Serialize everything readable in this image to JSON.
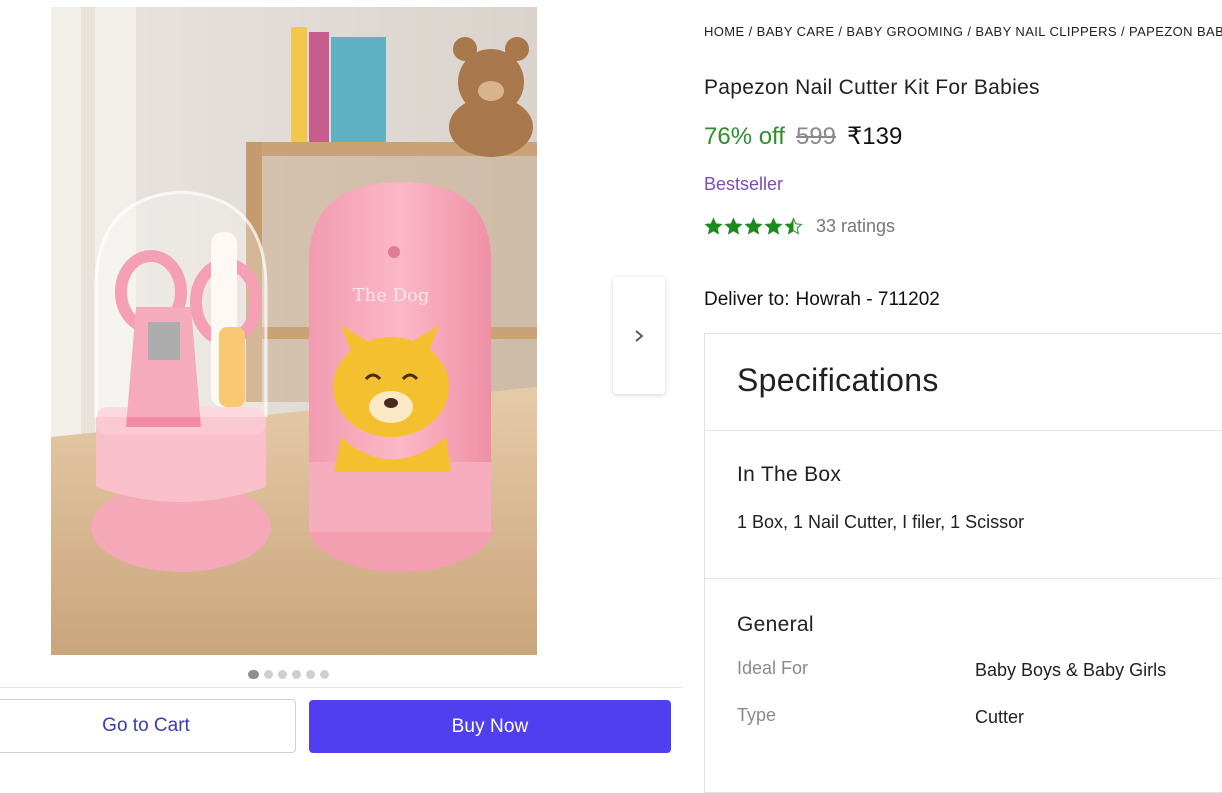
{
  "breadcrumb": [
    "HOME",
    "BABY CARE",
    "BABY GROOMING",
    "BABY NAIL CLIPPERS",
    "PAPEZON BABY"
  ],
  "product": {
    "title": "Papezon Nail Cutter Kit For Babies",
    "discount": "76% off",
    "mrp": "599",
    "price": "₹139",
    "badge": "Bestseller",
    "rating": 4.5,
    "rating_text": "33 ratings",
    "image_caption": "The Dog"
  },
  "delivery": {
    "label": "Deliver to:",
    "value": "Howrah - 711202"
  },
  "carousel": {
    "total": 6,
    "active": 1
  },
  "actions": {
    "cart": "Go to Cart",
    "buy": "Buy Now"
  },
  "specs": {
    "heading": "Specifications",
    "in_the_box": {
      "title": "In The Box",
      "value": "1 Box, 1 Nail Cutter, I filer, 1 Scissor"
    },
    "general": {
      "title": "General",
      "rows": [
        {
          "label": "Ideal For",
          "value": "Baby Boys & Baby Girls"
        },
        {
          "label": "Type",
          "value": "Cutter"
        }
      ]
    }
  },
  "colors": {
    "accent": "#4f3ff0",
    "discount": "#2f8f2f",
    "badge": "#7a4fb5",
    "star": "#1f8a1f"
  },
  "icons": {
    "next": "chevron-right-icon",
    "star": "star-icon"
  }
}
